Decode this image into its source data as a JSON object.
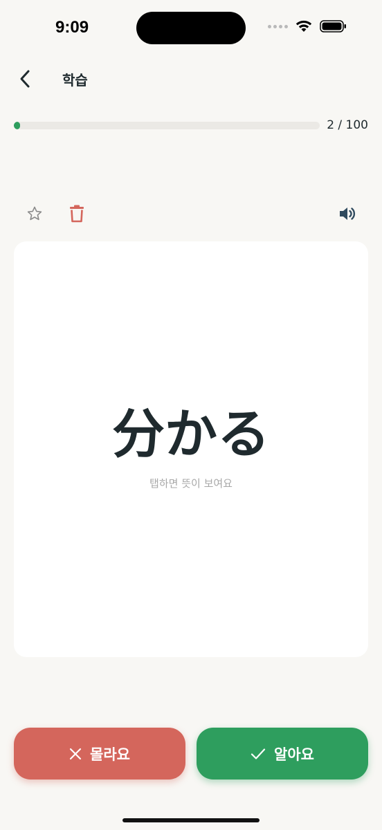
{
  "status_bar": {
    "time": "9:09"
  },
  "header": {
    "title": "학습",
    "back_icon": "chevron-left-icon"
  },
  "progress": {
    "text": "2 / 100",
    "current": 2,
    "total": 100,
    "fill_color": "#2e9e5e"
  },
  "actions": {
    "star_icon": "star-outline-icon",
    "delete_icon": "trash-icon",
    "sound_icon": "speaker-icon"
  },
  "card": {
    "word": "分かる",
    "hint": "탭하면 뜻이 보여요"
  },
  "buttons": {
    "dont_know": {
      "label": "몰라요",
      "icon": "close-icon",
      "color": "#d4665c"
    },
    "know": {
      "label": "알아요",
      "icon": "check-icon",
      "color": "#2e9e5e"
    }
  }
}
